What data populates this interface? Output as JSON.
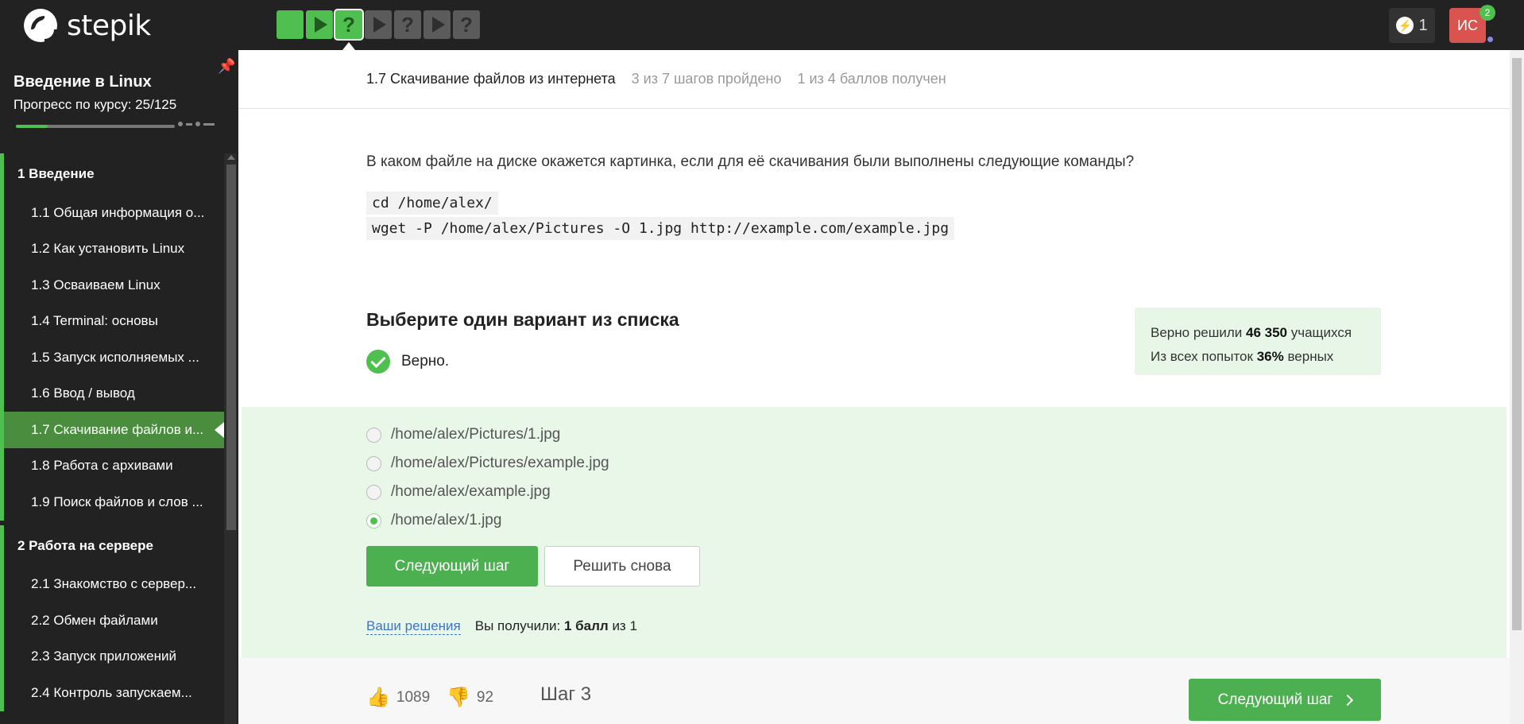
{
  "app": {
    "logo_text": "stepik",
    "energy_count": "1",
    "avatar_initials": "ИС",
    "notifications": "2"
  },
  "step_bar": [
    {
      "icon": "filled",
      "state": "done"
    },
    {
      "icon": "play-icon",
      "state": "done"
    },
    {
      "icon": "?",
      "state": "done-current"
    },
    {
      "icon": "play-icon",
      "state": "todo"
    },
    {
      "icon": "?",
      "state": "todo"
    },
    {
      "icon": "play-icon",
      "state": "todo"
    },
    {
      "icon": "?",
      "state": "todo"
    }
  ],
  "sidebar": {
    "course_title": "Введение в Linux",
    "progress_label": "Прогресс по курсу:  25/125",
    "progress_fraction": 0.2,
    "modules": [
      {
        "label": "1  Введение",
        "lessons": [
          "1.1  Общая информация о...",
          "1.2  Как установить Linux",
          "1.3  Осваиваем Linux",
          "1.4  Terminal: основы",
          "1.5  Запуск исполняемых ...",
          "1.6  Ввод / вывод",
          "1.7  Скачивание файлов и...",
          "1.8  Работа с архивами",
          "1.9  Поиск файлов и слов ..."
        ]
      },
      {
        "label": "2  Работа на сервере",
        "lessons": [
          "2.1  Знакомство с сервер...",
          "2.2  Обмен файлами",
          "2.3  Запуск приложений",
          "2.4  Контроль запускаем..."
        ]
      }
    ]
  },
  "lesson_header": {
    "title": "1.7 Скачивание файлов из интернета",
    "steps_done": "3 из 7 шагов пройдено",
    "points": "1 из 4 баллов  получен"
  },
  "question": {
    "text": "В каком файле на диске окажется картинка, если для её скачивания были выполнены следующие команды?",
    "code_lines": [
      "cd /home/alex/",
      "wget -P /home/alex/Pictures -O 1.jpg http://example.com/example.jpg"
    ],
    "task_title": "Выберите один вариант из списка",
    "status": "Верно."
  },
  "stats": {
    "line1_prefix": "Верно решили",
    "line1_value": "46 350",
    "line1_suffix": "учащихся",
    "line2_prefix": "Из всех попыток",
    "line2_value": "36%",
    "line2_suffix": "верных"
  },
  "options": [
    {
      "label": "/home/alex/Pictures/1.jpg",
      "selected": false
    },
    {
      "label": "/home/alex/Pictures/example.jpg",
      "selected": false
    },
    {
      "label": "/home/alex/example.jpg",
      "selected": false
    },
    {
      "label": "/home/alex/1.jpg",
      "selected": true
    }
  ],
  "actions": {
    "next_step": "Следующий шаг",
    "retry": "Решить снова",
    "your_solutions": "Ваши решения",
    "score_prefix": "Вы получили:",
    "score_value": "1 балл",
    "score_suffix": "из 1"
  },
  "footer": {
    "likes": "1089",
    "dislikes": "92",
    "step_label": "Шаг 3",
    "next_step": "Следующий шаг"
  },
  "colors": {
    "topbar_bg": "#222222",
    "accent_green": "#4caf50",
    "answer_bg": "#e9f7e9",
    "avatar_red": "#d9534f"
  }
}
